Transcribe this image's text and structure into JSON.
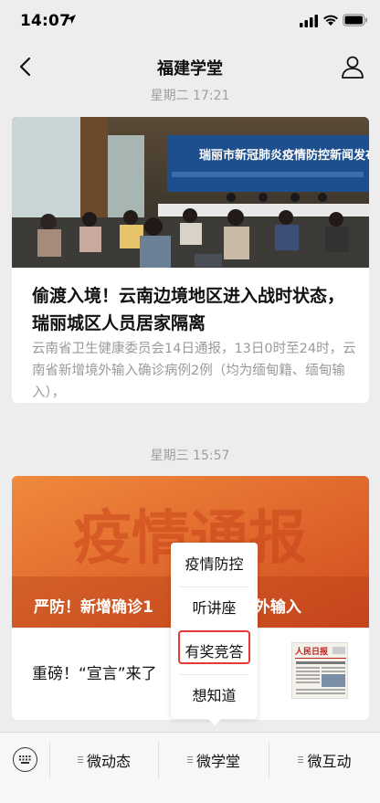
{
  "status_bar": {
    "time": "14:07"
  },
  "nav": {
    "title": "福建学堂"
  },
  "messages": [
    {
      "timestamp": "星期二 17:21",
      "image_banner_text": "瑞丽市新冠肺炎疫情防控新闻发布会",
      "title": "偷渡入境！云南边境地区进入战时状态，瑞丽城区人员居家隔离",
      "description": "云南省卫生健康委员会14日通报，13日0时至24时，云南省新增境外输入确诊病例2例（均为缅甸籍、缅甸输入），"
    },
    {
      "timestamp": "星期三 15:57",
      "banner_big_text": "疫情通报",
      "banner_headline": "严防！新增确诊1",
      "banner_headline_tail": "境外输入",
      "sub_title": "重磅！“宣言”来了",
      "thumb_logo": "人民日报"
    }
  ],
  "popup_menu": {
    "items": [
      "疫情防控",
      "听讲座",
      "有奖竞答",
      "想知道"
    ],
    "highlighted_index": 2
  },
  "bottom_menu": {
    "tabs": [
      "微动态",
      "微学堂",
      "微互动"
    ]
  },
  "icons": {
    "back": "chevron-left-icon",
    "profile": "person-icon",
    "keyboard": "keyboard-icon"
  }
}
